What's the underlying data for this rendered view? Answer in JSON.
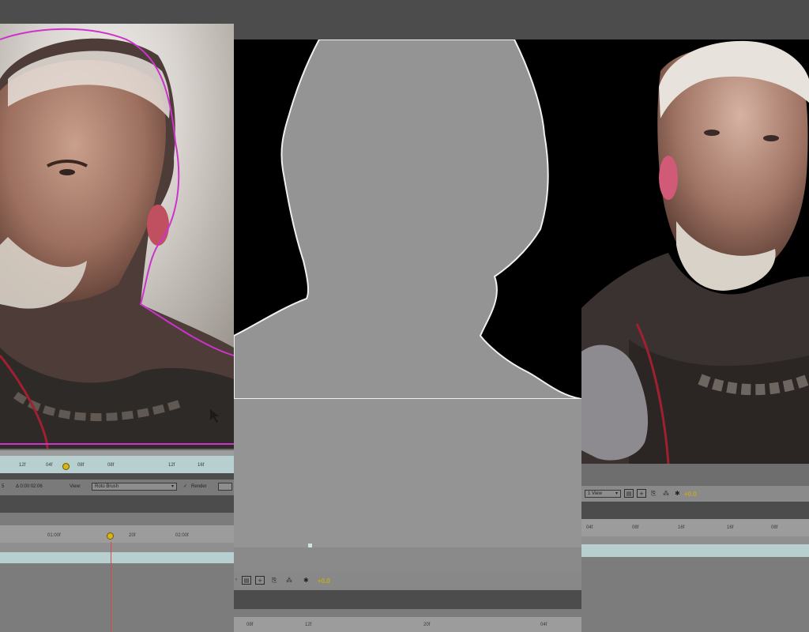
{
  "left_panel": {
    "ruler_ticks": [
      "12f",
      "04f",
      "08f",
      "08f",
      "12f",
      "16f"
    ],
    "timecode_start": "5",
    "timecode": "Δ 0:00:02:06",
    "view_label": "View:",
    "view_value": "Roto Brush",
    "render_label": "Render",
    "timeline_ticks": [
      "01:00f",
      "20f",
      "02:00f"
    ]
  },
  "mid_panel": {
    "offset_value": "+0.0",
    "bottom_ticks": [
      "08f",
      "12f",
      "20f",
      "04f"
    ]
  },
  "right_panel": {
    "view_value": "1 View",
    "offset_value": "+0.0",
    "ruler_ticks": [
      "04f",
      "08f",
      "16f",
      "16f",
      "08f"
    ]
  },
  "colors": {
    "outline_magenta": "#cc33cc",
    "playhead_yellow": "#d7b51a",
    "teal_track": "#b7cfcf"
  }
}
